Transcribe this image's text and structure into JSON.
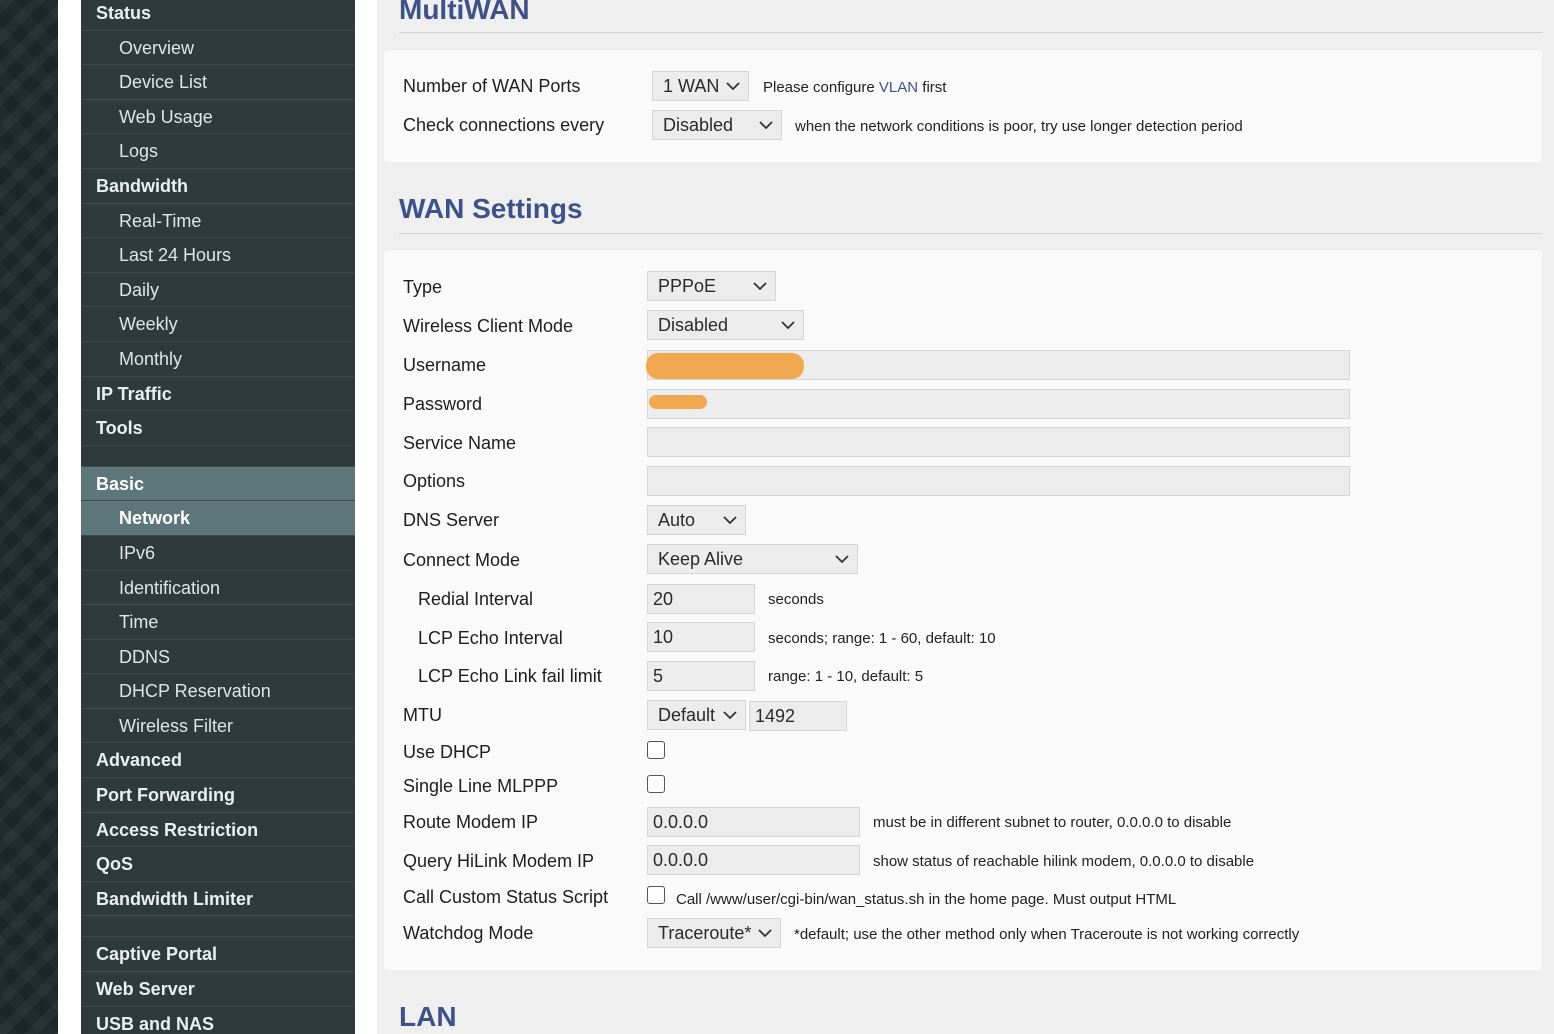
{
  "sidebar": {
    "items": [
      {
        "label": "Status",
        "level": "top"
      },
      {
        "label": "Overview",
        "level": "sub"
      },
      {
        "label": "Device List",
        "level": "sub"
      },
      {
        "label": "Web Usage",
        "level": "sub"
      },
      {
        "label": "Logs",
        "level": "sub"
      },
      {
        "label": "Bandwidth",
        "level": "top"
      },
      {
        "label": "Real-Time",
        "level": "sub"
      },
      {
        "label": "Last 24 Hours",
        "level": "sub"
      },
      {
        "label": "Daily",
        "level": "sub"
      },
      {
        "label": "Weekly",
        "level": "sub"
      },
      {
        "label": "Monthly",
        "level": "sub"
      },
      {
        "label": "IP Traffic",
        "level": "top"
      },
      {
        "label": "Tools",
        "level": "top"
      },
      {
        "label": "Basic",
        "level": "top"
      },
      {
        "label": "Network",
        "level": "sub"
      },
      {
        "label": "IPv6",
        "level": "sub"
      },
      {
        "label": "Identification",
        "level": "sub"
      },
      {
        "label": "Time",
        "level": "sub"
      },
      {
        "label": "DDNS",
        "level": "sub"
      },
      {
        "label": "DHCP Reservation",
        "level": "sub"
      },
      {
        "label": "Wireless Filter",
        "level": "sub"
      },
      {
        "label": "Advanced",
        "level": "top"
      },
      {
        "label": "Port Forwarding",
        "level": "top"
      },
      {
        "label": "Access Restriction",
        "level": "top"
      },
      {
        "label": "QoS",
        "level": "top"
      },
      {
        "label": "Bandwidth Limiter",
        "level": "top"
      },
      {
        "label": "Captive Portal",
        "level": "top"
      },
      {
        "label": "Web Server",
        "level": "top"
      },
      {
        "label": "USB and NAS",
        "level": "top"
      }
    ],
    "active_item": "Network",
    "active_group": "Basic"
  },
  "multiwan": {
    "title": "MultiWAN",
    "wan_ports": {
      "label": "Number of WAN Ports",
      "value": "1 WAN",
      "hint_prefix": "Please configure",
      "hint_link": "VLAN",
      "hint_suffix": "first"
    },
    "check_connections": {
      "label": "Check connections every",
      "value": "Disabled",
      "hint": "when the network conditions is poor, try use longer detection period"
    }
  },
  "wan_settings": {
    "title": "WAN Settings",
    "type": {
      "label": "Type",
      "value": "PPPoE"
    },
    "wireless_client_mode": {
      "label": "Wireless Client Mode",
      "value": "Disabled"
    },
    "username": {
      "label": "Username",
      "value": "[redacted]"
    },
    "password": {
      "label": "Password",
      "value": "[redacted]"
    },
    "service_name": {
      "label": "Service Name",
      "value": ""
    },
    "options": {
      "label": "Options",
      "value": ""
    },
    "dns_server": {
      "label": "DNS Server",
      "value": "Auto"
    },
    "connect_mode": {
      "label": "Connect Mode",
      "value": "Keep Alive"
    },
    "redial_interval": {
      "label": "Redial Interval",
      "value": "20",
      "hint": "seconds"
    },
    "lcp_echo_interval": {
      "label": "LCP Echo Interval",
      "value": "10",
      "hint": "seconds; range: 1 - 60, default: 10"
    },
    "lcp_echo_fail": {
      "label": "LCP Echo Link fail limit",
      "value": "5",
      "hint": "range: 1 - 10, default: 5"
    },
    "mtu": {
      "label": "MTU",
      "mode": "Default",
      "value": "1492"
    },
    "use_dhcp": {
      "label": "Use DHCP",
      "checked": false
    },
    "single_line_mlppp": {
      "label": "Single Line MLPPP",
      "checked": false
    },
    "route_modem_ip": {
      "label": "Route Modem IP",
      "value": "0.0.0.0",
      "hint": "must be in different subnet to router, 0.0.0.0 to disable"
    },
    "query_hilink": {
      "label": "Query HiLink Modem IP",
      "value": "0.0.0.0",
      "hint": "show status of reachable hilink modem, 0.0.0.0 to disable"
    },
    "custom_status_script": {
      "label": "Call Custom Status Script",
      "checked": false,
      "hint": "Call /www/user/cgi-bin/wan_status.sh in the home page. Must output HTML"
    },
    "watchdog_mode": {
      "label": "Watchdog Mode",
      "value": "Traceroute*",
      "hint": "*default; use the other method only when Traceroute is not working correctly"
    }
  },
  "lan": {
    "title": "LAN"
  },
  "colors": {
    "heading": "#3d5289",
    "sidebar_bg": "#2f3a3c",
    "sidebar_active": "#5d7679",
    "redaction": "#f0a94e"
  }
}
